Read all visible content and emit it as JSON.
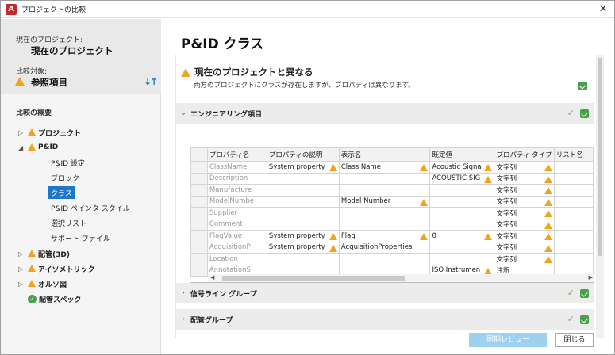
{
  "window": {
    "title": "プロジェクトの比較"
  },
  "left": {
    "current_label": "現在のプロジェクト:",
    "current_value": "現在のプロジェクト",
    "compare_label": "比較対象:",
    "compare_value": "参照項目",
    "overview_title": "比較の概要",
    "tree": [
      {
        "label": "プロジェクト",
        "arrow": "▷"
      },
      {
        "label": "P&ID",
        "arrow": "◢"
      },
      {
        "label": "P&ID 設定"
      },
      {
        "label": "ブロック"
      },
      {
        "label": "クラス"
      },
      {
        "label": "P&ID ペインタ スタイル"
      },
      {
        "label": "選択リスト"
      },
      {
        "label": "サポート ファイル"
      },
      {
        "label": "配管(3D)",
        "arrow": "▷"
      },
      {
        "label": "アイソメトリック",
        "arrow": "▷"
      },
      {
        "label": "オルソ図",
        "arrow": "▷"
      },
      {
        "label": "配管スペック"
      }
    ]
  },
  "main": {
    "title": "P&ID クラス",
    "diff_heading": "現在のプロジェクトと異なる",
    "diff_desc": "両方のプロジェクトにクラスが存在しますが、プロパティは異なります。",
    "sections": [
      {
        "label": "エンジニアリング項目",
        "chev": "⌄"
      },
      {
        "label": "信号ライン グループ",
        "chev": "›"
      },
      {
        "label": "配管グループ",
        "chev": "›"
      }
    ],
    "table": {
      "headers": [
        "プロパティ名",
        "プロパティの説明",
        "表示名",
        "既定値",
        "プロパティ タイプ",
        "リスト名"
      ],
      "rows": [
        [
          "ClassName",
          "System property",
          "Class Name",
          "Acoustic Signa",
          "文字列",
          ""
        ],
        [
          "Description",
          "",
          "",
          "ACOUSTIC SIG",
          "文字列",
          ""
        ],
        [
          "Manufacture",
          "",
          "",
          "",
          "文字列",
          ""
        ],
        [
          "ModelNumbe",
          "",
          "Model Number",
          "",
          "文字列",
          ""
        ],
        [
          "Supplier",
          "",
          "",
          "",
          "文字列",
          ""
        ],
        [
          "Comment",
          "",
          "",
          "",
          "文字列",
          ""
        ],
        [
          "FlagValue",
          "System property",
          "Flag",
          "0",
          "文字列",
          ""
        ],
        [
          "AcquisitionP",
          "System property",
          "AcquisitionProperties",
          "",
          "文字列",
          ""
        ],
        [
          "Location",
          "",
          "",
          "",
          "文字列",
          ""
        ],
        [
          "AnnotationS",
          "",
          "",
          "ISO Instrumen",
          "注釈",
          ""
        ]
      ]
    }
  },
  "buttons": {
    "sync": "同期レビュー",
    "close": "閉じる"
  },
  "colors": {
    "accent": "#1e78c8",
    "warning": "#f2a31f",
    "ok": "#4aa04a"
  }
}
